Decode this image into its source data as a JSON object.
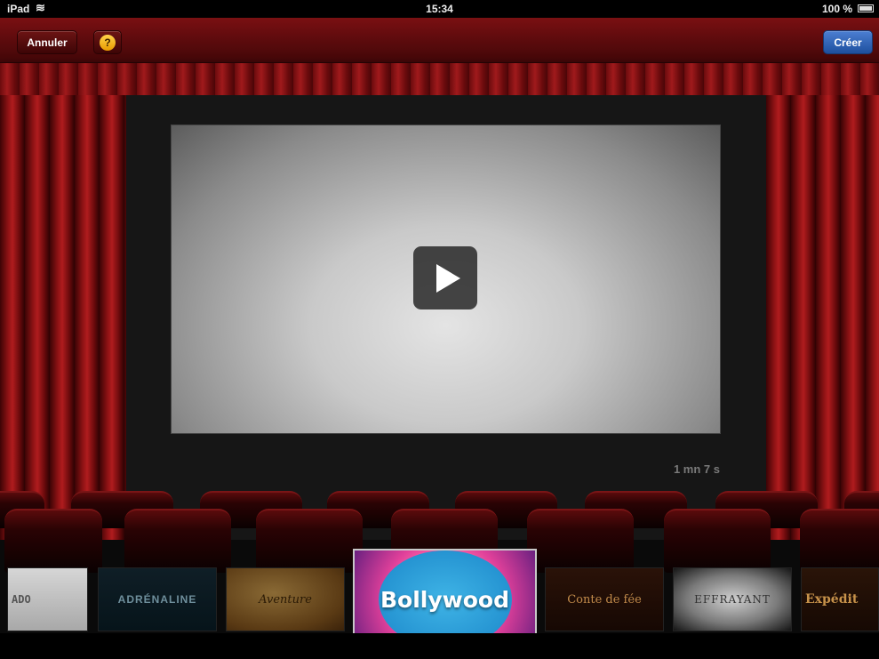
{
  "status_bar": {
    "carrier": "iPad",
    "time": "15:34",
    "battery": "100 %"
  },
  "toolbar": {
    "cancel_label": "Annuler",
    "help_label": "?",
    "create_label": "Créer"
  },
  "preview": {
    "duration": "1 mn 7 s"
  },
  "themes": [
    {
      "label": "ADO"
    },
    {
      "label": "ADRÉNALINE"
    },
    {
      "label": "Aventure"
    },
    {
      "label": "Bollywood",
      "selected": true
    },
    {
      "label": "Conte de fée"
    },
    {
      "label": "EFFRAYANT"
    },
    {
      "label": "Expédit"
    }
  ],
  "colors": {
    "toolbar": "#5d0b0d",
    "create_button": "#2d63b8",
    "curtain": "#8c1214",
    "help_icon": "#f2b21a"
  }
}
